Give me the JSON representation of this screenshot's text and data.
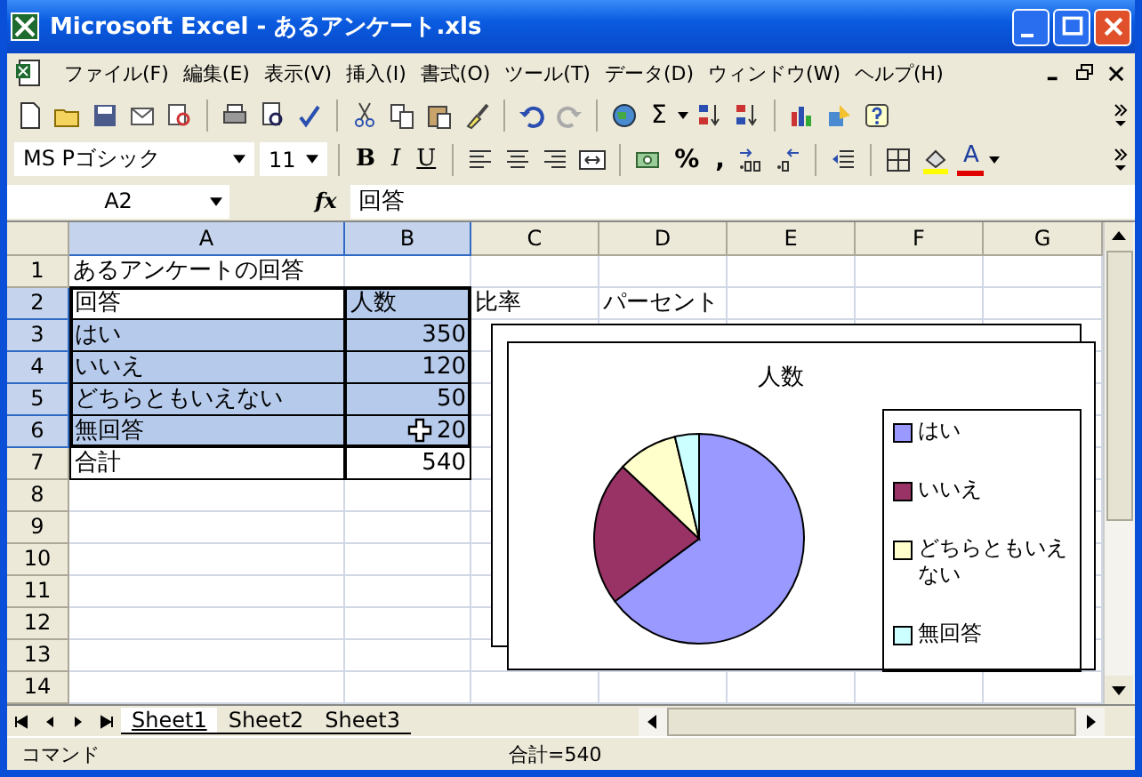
{
  "window": {
    "title": "Microsoft Excel - あるアンケート.xls"
  },
  "menu": [
    "ファイル(F)",
    "編集(E)",
    "表示(V)",
    "挿入(I)",
    "書式(O)",
    "ツール(T)",
    "データ(D)",
    "ウィンドウ(W)",
    "ヘルプ(H)"
  ],
  "standard_toolbar": {
    "sum_button": "Σ"
  },
  "format_toolbar": {
    "font": "MS Pゴシック",
    "size": "11",
    "style_buttons": [
      "B",
      "I",
      "U"
    ],
    "number_buttons": [
      "%",
      ","
    ],
    "font_color_button": "A"
  },
  "formula_bar": {
    "name_box": "A2",
    "fx_label": "fx",
    "value": "回答"
  },
  "columns": [
    {
      "label": "A",
      "selected": true
    },
    {
      "label": "B",
      "selected": true
    },
    {
      "label": "C",
      "selected": false
    },
    {
      "label": "D",
      "selected": false
    },
    {
      "label": "E",
      "selected": false
    },
    {
      "label": "F",
      "selected": false
    },
    {
      "label": "G",
      "selected": false
    }
  ],
  "rows": [
    {
      "label": "1",
      "selected": false,
      "bordered": false,
      "cells": [
        {
          "text": "あるアンケートの回答",
          "kind": "text"
        }
      ]
    },
    {
      "label": "2",
      "selected": true,
      "bordered": true,
      "cells": [
        {
          "text": "回答",
          "kind": "text",
          "active": true
        },
        {
          "text": "人数",
          "kind": "text"
        },
        {
          "text": "比率",
          "kind": "text"
        },
        {
          "text": "パーセント",
          "kind": "text"
        }
      ]
    },
    {
      "label": "3",
      "selected": true,
      "bordered": true,
      "cells": [
        {
          "text": "はい",
          "kind": "text"
        },
        {
          "text": "350",
          "kind": "number"
        }
      ]
    },
    {
      "label": "4",
      "selected": true,
      "bordered": true,
      "cells": [
        {
          "text": "いいえ",
          "kind": "text"
        },
        {
          "text": "120",
          "kind": "number"
        }
      ]
    },
    {
      "label": "5",
      "selected": true,
      "bordered": true,
      "cells": [
        {
          "text": "どちらともいえない",
          "kind": "text"
        },
        {
          "text": "50",
          "kind": "number"
        }
      ]
    },
    {
      "label": "6",
      "selected": true,
      "bordered": true,
      "cells": [
        {
          "text": "無回答",
          "kind": "text"
        },
        {
          "text": "20",
          "kind": "number"
        }
      ]
    },
    {
      "label": "7",
      "selected": false,
      "bordered": true,
      "cells": [
        {
          "text": "合計",
          "kind": "text"
        },
        {
          "text": "540",
          "kind": "number"
        }
      ]
    },
    {
      "label": "8",
      "selected": false,
      "bordered": false,
      "cells": []
    },
    {
      "label": "9",
      "selected": false,
      "bordered": false,
      "cells": []
    },
    {
      "label": "10",
      "selected": false,
      "bordered": false,
      "cells": []
    },
    {
      "label": "11",
      "selected": false,
      "bordered": false,
      "cells": []
    },
    {
      "label": "12",
      "selected": false,
      "bordered": false,
      "cells": []
    },
    {
      "label": "13",
      "selected": false,
      "bordered": false,
      "cells": []
    },
    {
      "label": "14",
      "selected": false,
      "bordered": false,
      "cells": []
    }
  ],
  "chart": {
    "chart_data": {
      "type": "pie",
      "categories": [
        "はい",
        "いいえ",
        "どちらともいえない",
        "無回答"
      ],
      "series": [
        {
          "name": "人数",
          "values": [
            64.82,
            22.22,
            9.26,
            3.7
          ]
        }
      ],
      "legend": "right"
    },
    "slice_colors": [
      {
        "color": "#9999ff"
      },
      {
        "color": "#993366"
      },
      {
        "color": "#ffffcc"
      },
      {
        "color": "#ccffff"
      }
    ]
  },
  "sheet_tabs": [
    {
      "label": "Sheet1",
      "selected": true
    },
    {
      "label": "Sheet2",
      "selected": false
    },
    {
      "label": "Sheet3",
      "selected": false
    }
  ],
  "status_bar": {
    "mode": "コマンド",
    "summary": "合計=540"
  }
}
